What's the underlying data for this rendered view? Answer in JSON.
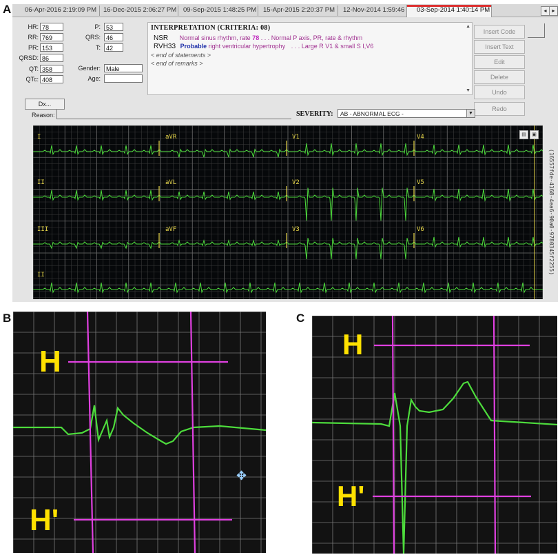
{
  "panels": {
    "a": "A",
    "b": "B",
    "c": "C"
  },
  "tabs": [
    "06-Apr-2016 2:19:09 PM",
    "16-Dec-2015 2:06:27 PM",
    "09-Sep-2015 1:48:25 PM",
    "15-Apr-2015 2:20:37 PM",
    "12-Nov-2014 1:59:46 PM",
    "03-Sep-2014 1:40:14 PM"
  ],
  "nav": {
    "prev": "◂",
    "next": "▸"
  },
  "measurements": {
    "hr": {
      "label": "HR:",
      "value": "78"
    },
    "rr": {
      "label": "RR:",
      "value": "769"
    },
    "pr": {
      "label": "PR:",
      "value": "153"
    },
    "qrsd": {
      "label": "QRSD:",
      "value": "86"
    },
    "qt": {
      "label": "QT:",
      "value": "358"
    },
    "qtc": {
      "label": "QTc:",
      "value": "408"
    },
    "p": {
      "label": "P:",
      "value": "53"
    },
    "qrs": {
      "label": "QRS:",
      "value": "46"
    },
    "t": {
      "label": "T:",
      "value": "42"
    },
    "gender": {
      "label": "Gender:",
      "value": "Male"
    },
    "age": {
      "label": "Age:",
      "value": ""
    }
  },
  "interpretation": {
    "title": "INTERPRETATION (CRITERIA: 08)",
    "nsr_code": "NSR",
    "nsr_text": "Normal sinus rhythm, rate",
    "nsr_rate": "78",
    "nsr_rest": ". . . Normal P axis, PR, rate & rhythm",
    "rvh_code": "RVH33",
    "rvh_prob": "Probable",
    "rvh_text": "right ventricular hypertrophy",
    "rvh_rest": ". . . Large R V1 & small S I,V6",
    "end_statements": "< end of statements >",
    "end_remarks": "< end of remarks >"
  },
  "side_buttons": [
    "Insert Code",
    "Insert Text",
    "Edit",
    "Delete",
    "Undo",
    "Redo"
  ],
  "dx_label": "Dx...",
  "reason_label": "Reason:",
  "severity": {
    "label": "SEVERITY:",
    "value": "AB - ABNORMAL ECG -"
  },
  "leads": [
    "I",
    "aVR",
    "V1",
    "V4",
    "II",
    "aVL",
    "V2",
    "V5",
    "III",
    "aVF",
    "V3",
    "V6",
    "II"
  ],
  "ecg_id": "(16557fde-4168-4ea6-90a0-9780345f2255)",
  "markers": {
    "h": "H",
    "h_prime": "H'"
  },
  "colors": {
    "trace": "#4ddc3c",
    "grid": "#7a7a7a",
    "lead_label": "#e8d84a",
    "marker": "#e040e0",
    "label": "#ffe100"
  }
}
